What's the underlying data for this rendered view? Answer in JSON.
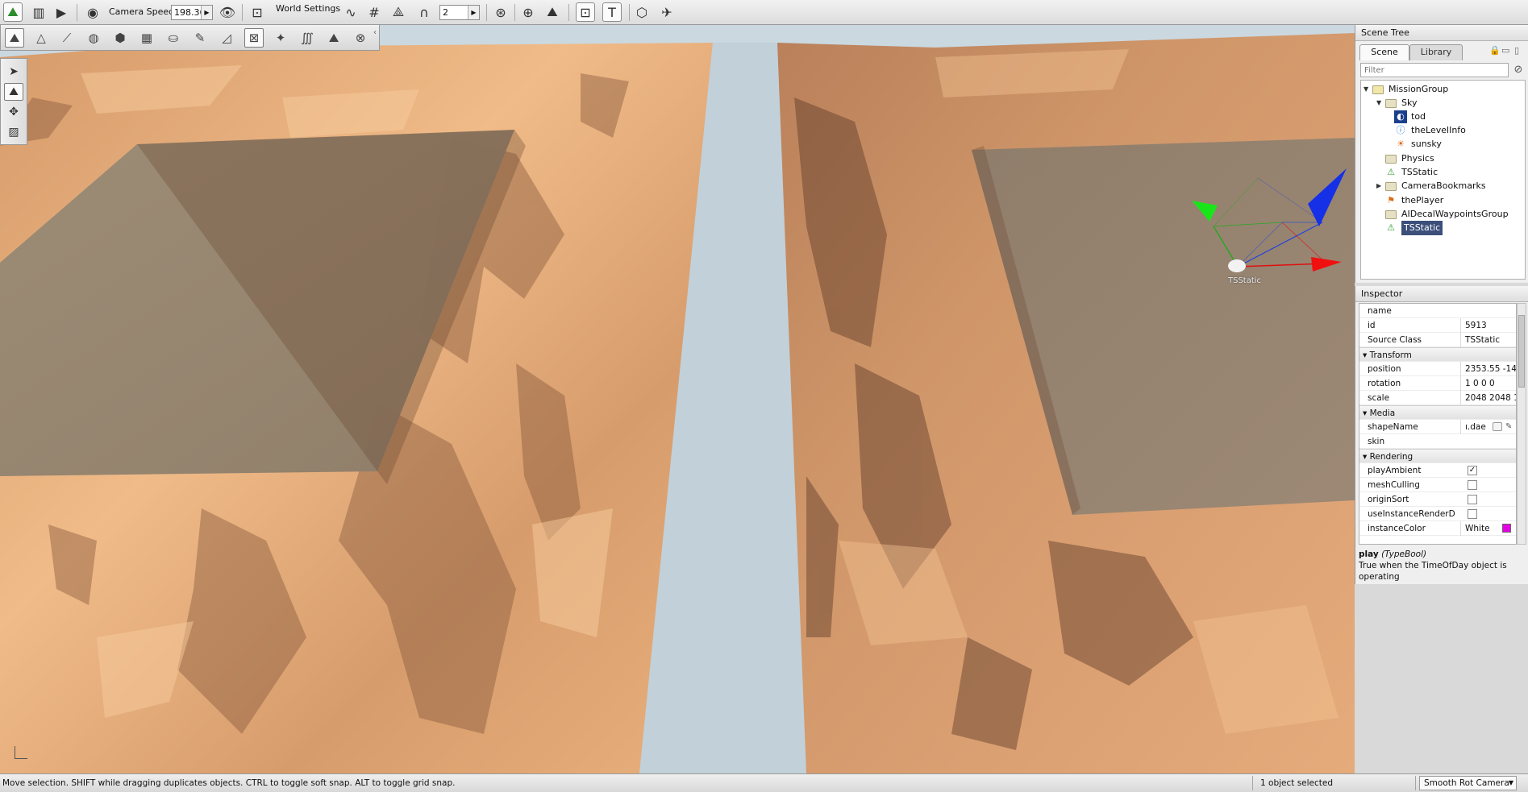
{
  "toolbar": {
    "camera_speed_label": "Camera Speed",
    "camera_speed_value": "198.36",
    "world_settings_label": "World Settings",
    "snap_value": "2"
  },
  "scene_tree": {
    "title": "Scene Tree",
    "tabs": [
      "Scene",
      "Library"
    ],
    "filter_placeholder": "Filter",
    "nodes": [
      {
        "label": "MissionGroup",
        "icon": "open-folder-icon"
      },
      {
        "label": "Sky",
        "icon": "open-folder-icon"
      },
      {
        "label": "tod",
        "icon": "time-of-day-icon"
      },
      {
        "label": "theLevelInfo",
        "icon": "info-icon"
      },
      {
        "label": "sunsky",
        "icon": "sun-icon"
      },
      {
        "label": "Physics",
        "icon": "folder-icon"
      },
      {
        "label": "TSStatic",
        "icon": "static-shape-icon"
      },
      {
        "label": "CameraBookmarks",
        "icon": "folder-icon"
      },
      {
        "label": "thePlayer",
        "icon": "spawn-icon"
      },
      {
        "label": "AIDecalWaypointsGroup",
        "icon": "folder-icon"
      },
      {
        "label": "TSStatic",
        "icon": "static-shape-icon"
      }
    ]
  },
  "inspector": {
    "title": "Inspector",
    "rows": {
      "name": {
        "label": "name",
        "value": ""
      },
      "id": {
        "label": "id",
        "value": "5913"
      },
      "source_class": {
        "label": "Source Class",
        "value": "TSStatic"
      },
      "transform_group": "Transform",
      "position": {
        "label": "position",
        "value": "2353.55 -14:"
      },
      "rotation": {
        "label": "rotation",
        "value": "1 0 0 0"
      },
      "scale": {
        "label": "scale",
        "value": "2048 2048 1"
      },
      "media_group": "Media",
      "shape_name": {
        "label": "shapeName",
        "value": "ı.dae"
      },
      "skin": {
        "label": "skin",
        "value": ""
      },
      "rendering_group": "Rendering",
      "play_ambient": {
        "label": "playAmbient",
        "checked": true
      },
      "mesh_culling": {
        "label": "meshCulling",
        "checked": false
      },
      "origin_sort": {
        "label": "originSort",
        "checked": false
      },
      "use_instance": {
        "label": "useInstanceRenderD",
        "checked": false
      },
      "instance_color": {
        "label": "instanceColor",
        "value": "White",
        "swatch": "#e600e6"
      }
    },
    "help_name": "play",
    "help_type": "(TypeBool)",
    "help_text": "True when the TimeOfDay object is operating"
  },
  "viewport": {
    "selected_object_label": "TSStatic",
    "colors": {
      "sky": "#c5d3dc",
      "terrain_light": "#e9b483",
      "terrain_dark": "#8a5b3d",
      "water": "#938572"
    }
  },
  "statusbar": {
    "hint": "Move selection.  SHIFT while dragging duplicates objects.  CTRL to toggle soft snap.  ALT to toggle grid snap.",
    "selection_count": "1 object selected",
    "camera_mode": "Smooth Rot Camera"
  }
}
